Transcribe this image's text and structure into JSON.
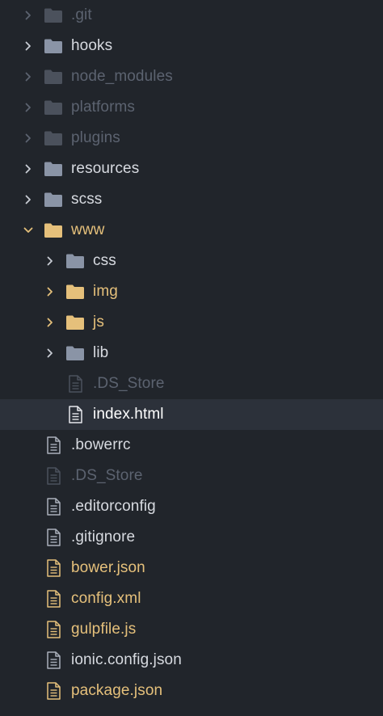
{
  "colors": {
    "background": "#21252b",
    "selected_row": "#2c313a",
    "text_normal": "#d7dae0",
    "text_ignored": "#5c6370",
    "text_modified": "#e5c07b",
    "folder_normal": "#8a94a6",
    "folder_ignored": "#4b515c",
    "folder_modified": "#e5c07b"
  },
  "tree": {
    "items": [
      {
        "label": ".git",
        "kind": "folder",
        "state": "ignored",
        "expanded": false,
        "depth": 0
      },
      {
        "label": "hooks",
        "kind": "folder",
        "state": "normal",
        "expanded": false,
        "depth": 0
      },
      {
        "label": "node_modules",
        "kind": "folder",
        "state": "ignored",
        "expanded": false,
        "depth": 0
      },
      {
        "label": "platforms",
        "kind": "folder",
        "state": "ignored",
        "expanded": false,
        "depth": 0
      },
      {
        "label": "plugins",
        "kind": "folder",
        "state": "ignored",
        "expanded": false,
        "depth": 0
      },
      {
        "label": "resources",
        "kind": "folder",
        "state": "normal",
        "expanded": false,
        "depth": 0
      },
      {
        "label": "scss",
        "kind": "folder",
        "state": "normal",
        "expanded": false,
        "depth": 0
      },
      {
        "label": "www",
        "kind": "folder",
        "state": "modified",
        "expanded": true,
        "depth": 0
      },
      {
        "label": "css",
        "kind": "folder",
        "state": "normal",
        "expanded": false,
        "depth": 1
      },
      {
        "label": "img",
        "kind": "folder",
        "state": "modified",
        "expanded": false,
        "depth": 1
      },
      {
        "label": "js",
        "kind": "folder",
        "state": "modified",
        "expanded": false,
        "depth": 1
      },
      {
        "label": "lib",
        "kind": "folder",
        "state": "normal",
        "expanded": false,
        "depth": 1
      },
      {
        "label": ".DS_Store",
        "kind": "file",
        "state": "ignored",
        "depth": 1
      },
      {
        "label": "index.html",
        "kind": "file",
        "state": "selected",
        "depth": 1,
        "selected": true
      },
      {
        "label": ".bowerrc",
        "kind": "file",
        "state": "normal",
        "depth": 0
      },
      {
        "label": ".DS_Store",
        "kind": "file",
        "state": "ignored",
        "depth": 0
      },
      {
        "label": ".editorconfig",
        "kind": "file",
        "state": "normal",
        "depth": 0
      },
      {
        "label": ".gitignore",
        "kind": "file",
        "state": "normal",
        "depth": 0
      },
      {
        "label": "bower.json",
        "kind": "file",
        "state": "modified",
        "depth": 0
      },
      {
        "label": "config.xml",
        "kind": "file",
        "state": "modified",
        "depth": 0
      },
      {
        "label": "gulpfile.js",
        "kind": "file",
        "state": "modified",
        "depth": 0
      },
      {
        "label": "ionic.config.json",
        "kind": "file",
        "state": "normal",
        "depth": 0
      },
      {
        "label": "package.json",
        "kind": "file",
        "state": "modified",
        "depth": 0
      }
    ]
  }
}
